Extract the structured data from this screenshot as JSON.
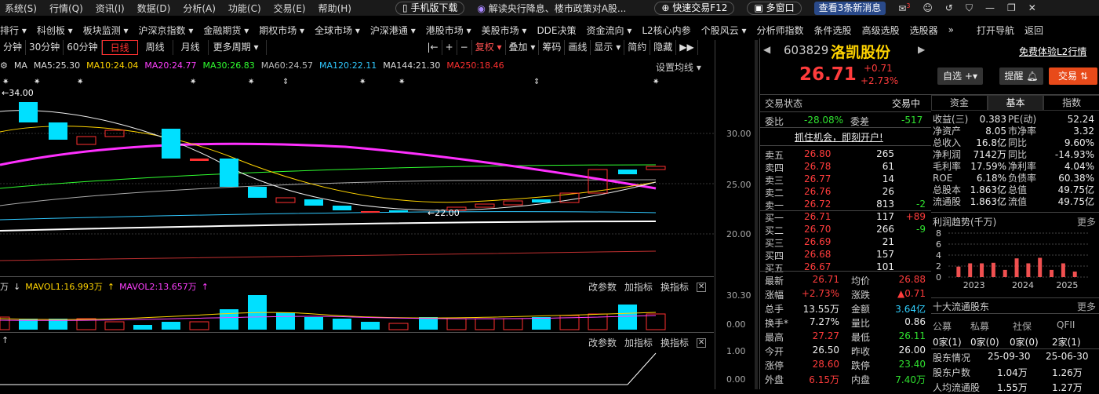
{
  "menubar": {
    "items": [
      "系统(S)",
      "行情(Q)",
      "资讯(I)",
      "数据(D)",
      "分析(A)",
      "功能(C)",
      "交易(E)",
      "帮助(H)"
    ],
    "mobile_download": "手机版下载",
    "news_headline": "解读央行降息、楼市政策对A股...",
    "quick_trade": "快速交易F12",
    "multi_window": "多窗口",
    "new_msgs": "查看3条新消息",
    "badge_count": "3"
  },
  "navbar": {
    "items": [
      "排行 ▾",
      "科创板 ▾",
      "板块监测 ▾",
      "沪深京指数 ▾",
      "金融期货 ▾",
      "期权市场 ▾",
      "全球市场 ▾",
      "沪深港通 ▾",
      "港股市场 ▾",
      "美股市场 ▾",
      "DDE决策",
      "资金流向 ▾",
      "L2核心内参",
      "个股风云 ▾",
      "分析师指数",
      "条件选股",
      "高级选股",
      "选股器",
      "»",
      "打开导航",
      "返回"
    ]
  },
  "toolbar": {
    "items": [
      "分钟",
      "30分钟",
      "60分钟",
      "日线",
      "周线",
      "月线",
      "更多周期 ▾"
    ],
    "active": "日线",
    "tools": [
      "|←",
      "+",
      "−",
      "复权 ▾",
      "叠加 ▾",
      "筹码",
      "画线",
      "显示 ▾",
      "简约",
      "隐藏",
      "▶▶"
    ]
  },
  "ma_line": {
    "ma": "MA",
    "ma5": "MA5:25.30",
    "ma10": "MA10:24.04",
    "ma20": "MA20:24.77",
    "ma30": "MA30:26.83",
    "ma60": "MA60:24.57",
    "ma120": "MA120:22.11",
    "ma144": "MA144:21.30",
    "ma250": "MA250:18.46",
    "setting": "设置均线 ▾"
  },
  "axis": {
    "price": [
      "30.00",
      "25.00",
      "20.00"
    ],
    "volume": [
      "30.30",
      "0.00"
    ],
    "indicator": [
      "1.00",
      "0.00"
    ]
  },
  "annot": {
    "high": "←34.00",
    "low": "←22.00"
  },
  "vol_line": {
    "unit": "万",
    "mavol1": "MAVOL1:16.993万",
    "mavol2": "MAVOL2:13.657万",
    "change_param": "改参数",
    "add_ind": "加指标",
    "switch_ind": "换指标"
  },
  "ind_line": {
    "change_param": "改参数",
    "add_ind": "加指标",
    "switch_ind": "换指标"
  },
  "stock": {
    "code": "603829",
    "name": "洛凯股份",
    "price": "26.71",
    "change": "+0.71",
    "change_pct": "+2.73%",
    "free_l2": "免费体验L2行情",
    "watch": "自选",
    "alert": "提醒",
    "trade": "交易"
  },
  "status": {
    "label": "交易状态",
    "value": "交易中",
    "wb_label": "委比",
    "wb": "-28.08%",
    "wc_label": "委差",
    "wc": "-517",
    "promo": "抓住机会，即刻开户!"
  },
  "asks": [
    {
      "l": "卖五",
      "p": "26.80",
      "v": "265",
      "d": ""
    },
    {
      "l": "卖四",
      "p": "26.78",
      "v": "61",
      "d": ""
    },
    {
      "l": "卖三",
      "p": "26.77",
      "v": "14",
      "d": ""
    },
    {
      "l": "卖二",
      "p": "26.76",
      "v": "26",
      "d": ""
    },
    {
      "l": "卖一",
      "p": "26.72",
      "v": "813",
      "d": "-2"
    }
  ],
  "bids": [
    {
      "l": "买一",
      "p": "26.71",
      "v": "117",
      "d": "+89"
    },
    {
      "l": "买二",
      "p": "26.70",
      "v": "266",
      "d": "-9"
    },
    {
      "l": "买三",
      "p": "26.69",
      "v": "21",
      "d": ""
    },
    {
      "l": "买四",
      "p": "26.68",
      "v": "157",
      "d": ""
    },
    {
      "l": "买五",
      "p": "26.67",
      "v": "101",
      "d": ""
    }
  ],
  "quote": [
    {
      "a": "最新",
      "av": "26.71",
      "b": "均价",
      "bv": "26.88"
    },
    {
      "a": "涨幅",
      "av": "+2.73%",
      "b": "涨跌",
      "bv": "▲0.71"
    },
    {
      "a": "总手",
      "av": "13.55万",
      "b": "金额",
      "bv": "3.64亿"
    },
    {
      "a": "换手*",
      "av": "7.27%",
      "b": "量比",
      "bv": "0.86"
    },
    {
      "a": "最高",
      "av": "27.27",
      "b": "最低",
      "bv": "26.11"
    },
    {
      "a": "今开",
      "av": "26.50",
      "b": "昨收",
      "bv": "26.00"
    },
    {
      "a": "涨停",
      "av": "28.60",
      "b": "跌停",
      "bv": "23.40"
    },
    {
      "a": "外盘",
      "av": "6.15万",
      "b": "内盘",
      "bv": "7.40万"
    }
  ],
  "ftabs": [
    "资金",
    "基本",
    "指数"
  ],
  "fund": [
    {
      "a": "收益(三)",
      "av": "0.383",
      "b": "PE(动)",
      "bv": "52.24"
    },
    {
      "a": "净资产",
      "av": "8.05",
      "b": "市净率",
      "bv": "3.32"
    },
    {
      "a": "总收入",
      "av": "16.8亿",
      "b": "同比",
      "bv": "9.60%"
    },
    {
      "a": "净利润",
      "av": "7142万",
      "b": "同比",
      "bv": "-14.93%"
    },
    {
      "a": "毛利率",
      "av": "17.59%",
      "b": "净利率",
      "bv": "4.04%"
    },
    {
      "a": "ROE",
      "av": "6.18%",
      "b": "负债率",
      "bv": "60.38%"
    },
    {
      "a": "总股本",
      "av": "1.863亿",
      "b": "总值",
      "bv": "49.75亿"
    },
    {
      "a": "流通股",
      "av": "1.863亿",
      "b": "流值",
      "bv": "49.75亿"
    }
  ],
  "profit": {
    "title": "利润趋势(千万)",
    "more": "更多",
    "yticks": [
      "8",
      "6",
      "4",
      "2",
      "0"
    ],
    "years": [
      "2023",
      "2024",
      "2025"
    ]
  },
  "chart_data": {
    "type": "bar",
    "categories": [
      "2023Q1",
      "2023Q2",
      "2023Q3",
      "2023Q4",
      "2024Q1",
      "2024Q2",
      "2024Q3",
      "2024Q4",
      "2025Q1",
      "2025Q2",
      "2025Q3"
    ],
    "values": [
      1.9,
      2.5,
      2.5,
      2.6,
      1.3,
      3.4,
      2.5,
      3.5,
      1.3,
      2.5,
      1.0
    ],
    "ylim": [
      0,
      8
    ],
    "title": "利润趋势(千万)"
  },
  "holders": {
    "title": "十大流通股东",
    "more": "更多",
    "cols": [
      "公募",
      "私募",
      "社保",
      "QFII"
    ],
    "vals": [
      "0家(1)",
      "0家(0)",
      "0家(0)",
      "2家(1)"
    ],
    "r1": [
      "股东情况",
      "25-09-30",
      "25-06-30"
    ],
    "r2": [
      "股东户数",
      "1.04万",
      "1.26万"
    ],
    "r3": [
      "人均流通股",
      "1.55万",
      "1.27万"
    ]
  }
}
